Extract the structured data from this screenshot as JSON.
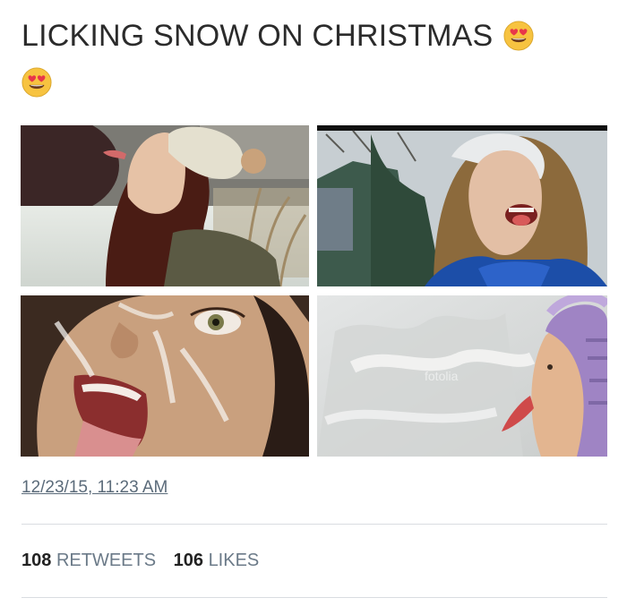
{
  "tweet": {
    "text": "LICKING SNOW ON CHRISTMAS",
    "emoji": [
      "heart-eyes-emoji",
      "heart-eyes-emoji"
    ],
    "timestamp": "12/23/15, 11:23 AM"
  },
  "photos": [
    {
      "name": "photo-woman-beanie-tongue-out"
    },
    {
      "name": "photo-girl-snow-hair-laughing"
    },
    {
      "name": "photo-face-closeup-covered"
    },
    {
      "name": "photo-child-purple-hat-tongue",
      "watermark": "fotolia"
    }
  ],
  "stats": {
    "retweets_count": "108",
    "retweets_label": "RETWEETS",
    "likes_count": "106",
    "likes_label": "LIKES"
  },
  "colors": {
    "text": "#2b2b2b",
    "timestamp": "#5b6b7a",
    "stat_label": "#6b7a88",
    "divider": "#d9dde1",
    "emoji_face": "#f7c340",
    "emoji_heart": "#e8364a"
  }
}
